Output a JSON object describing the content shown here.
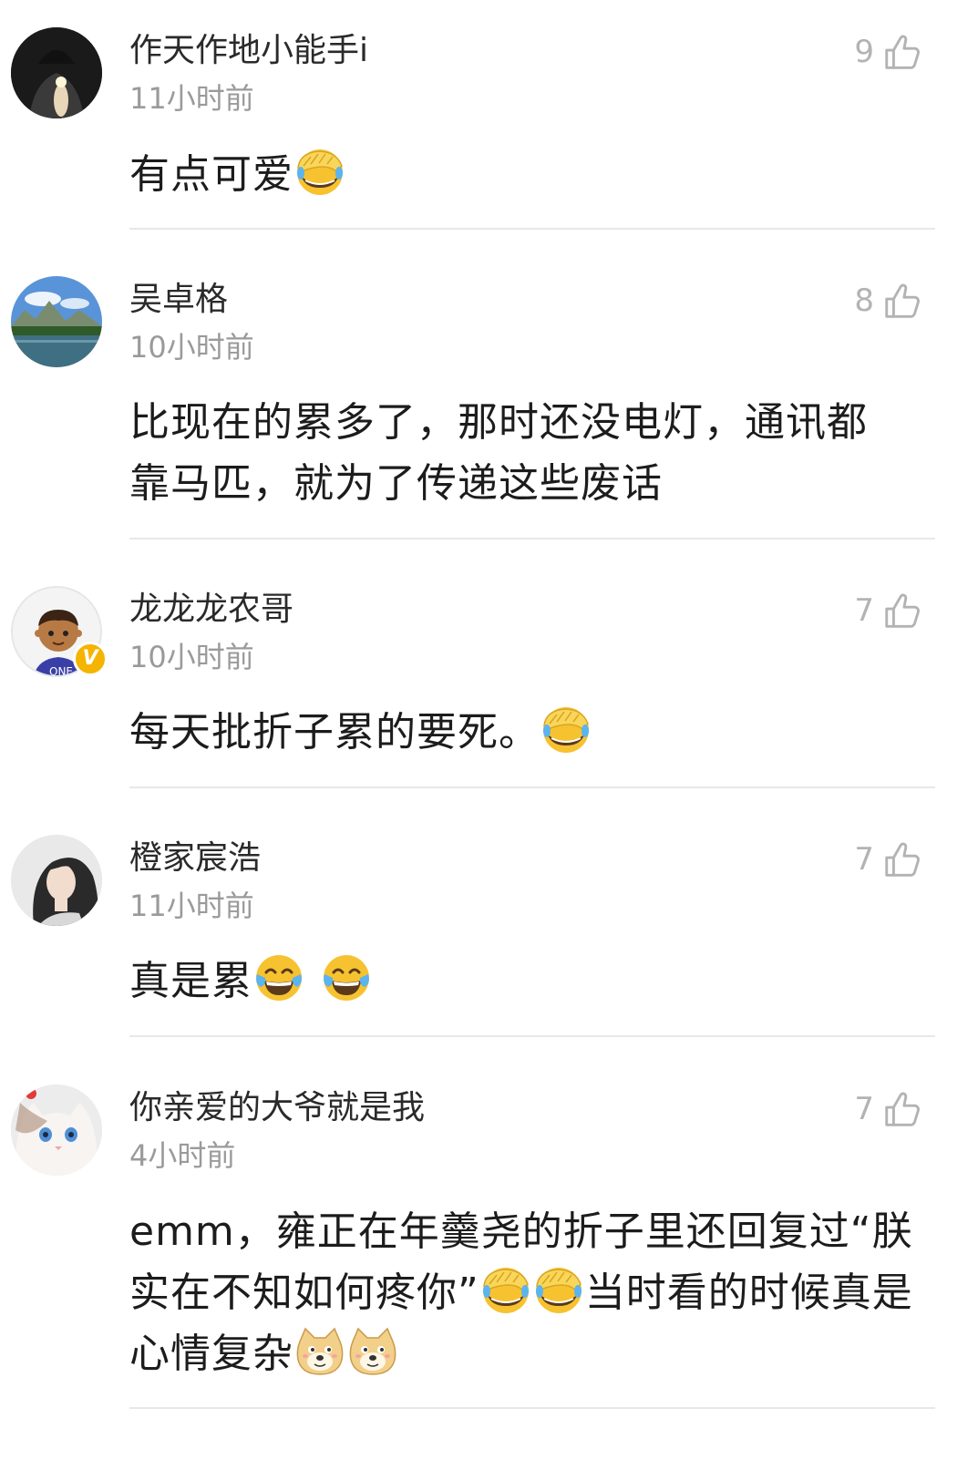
{
  "comments": [
    {
      "username": "作天作地小能手i",
      "time": "11小时前",
      "likes": "9",
      "text_parts": [
        "有点可爱",
        "",
        "",
        ""
      ],
      "emoji": [
        "facepalm-cry"
      ],
      "avatar": "dark-portrait",
      "verified": false
    },
    {
      "username": "吴卓格",
      "time": "10小时前",
      "likes": "8",
      "text_line1": "比现在的累多了，那时还没电灯，通讯都",
      "text_line2": "靠马匹，就为了传递这些废话",
      "avatar": "landscape-lake",
      "verified": false
    },
    {
      "username": "龙龙龙农哥",
      "time": "10小时前",
      "likes": "7",
      "text_parts": [
        "每天批折子累的要死。"
      ],
      "emoji": [
        "facepalm-cry"
      ],
      "avatar": "cartoon-boy",
      "verified": true,
      "verified_label": "V"
    },
    {
      "username": "橙家宸浩",
      "time": "11小时前",
      "likes": "7",
      "text_parts": [
        "真是累"
      ],
      "emoji": [
        "tears-of-joy",
        "tears-of-joy"
      ],
      "avatar": "girl-portrait",
      "verified": false
    },
    {
      "username": "你亲爱的大爷就是我",
      "time": "4小时前",
      "likes": "7",
      "text_line1": "emm，雍正在年羹尧的折子里还回复过“朕",
      "text_line2a": "实在不知如何疼你”",
      "text_line2b": "当时看的时候真是",
      "text_line3": "心情复杂",
      "emoji": [
        "facepalm-cry",
        "facepalm-cry",
        "doge",
        "doge"
      ],
      "avatar": "white-cat",
      "verified": false
    }
  ],
  "icons": {
    "like": "thumbs-up-outline-icon"
  },
  "colors": {
    "username": "#2a2a2a",
    "time": "#9a9a9a",
    "likes": "#b3b3b3",
    "divider": "#e8e8e8",
    "verified_badge": "#f5b400"
  }
}
